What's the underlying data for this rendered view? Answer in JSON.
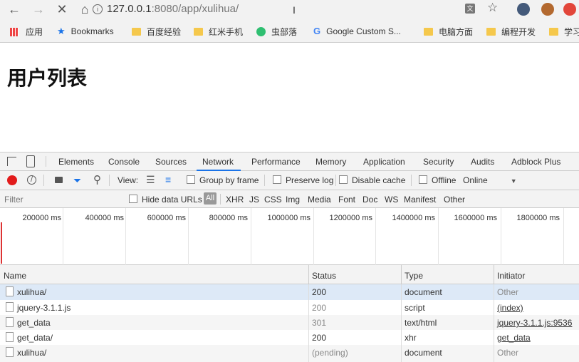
{
  "browser": {
    "url_host": "127.0.0.1",
    "url_rest": ":8080/app/xulihua/",
    "bookmarks": [
      "应用",
      "Bookmarks",
      "百度经验",
      "红米手机",
      "虫部落",
      "Google Custom S...",
      "电脑方面",
      "编程开发",
      "学习"
    ]
  },
  "page": {
    "title": "用户列表"
  },
  "devtools": {
    "tabs": [
      "Elements",
      "Console",
      "Sources",
      "Network",
      "Performance",
      "Memory",
      "Application",
      "Security",
      "Audits",
      "Adblock Plus"
    ],
    "active_tab": "Network",
    "toolbar": {
      "view_label": "View:",
      "group_by_frame": "Group by frame",
      "preserve_log": "Preserve log",
      "disable_cache": "Disable cache",
      "offline": "Offline",
      "throttle": "Online"
    },
    "filter": {
      "placeholder": "Filter",
      "hide_data_urls": "Hide data URLs",
      "all": "All",
      "types": [
        "XHR",
        "JS",
        "CSS",
        "Img",
        "Media",
        "Font",
        "Doc",
        "WS",
        "Manifest",
        "Other"
      ]
    },
    "timeline_ticks": [
      "200000 ms",
      "400000 ms",
      "600000 ms",
      "800000 ms",
      "1000000 ms",
      "1200000 ms",
      "1400000 ms",
      "1600000 ms",
      "1800000 ms"
    ],
    "columns": {
      "name": "Name",
      "status": "Status",
      "type": "Type",
      "initiator": "Initiator"
    },
    "requests": [
      {
        "name": "xulihua/",
        "status": "200",
        "type": "document",
        "initiator": "Other"
      },
      {
        "name": "jquery-3.1.1.js",
        "status": "200",
        "type": "script",
        "initiator": "(index)"
      },
      {
        "name": "get_data",
        "status": "301",
        "type": "text/html",
        "initiator": "jquery-3.1.1.js:9536"
      },
      {
        "name": "get_data/",
        "status": "200",
        "type": "xhr",
        "initiator": "get_data"
      },
      {
        "name": "xulihua/",
        "status": "(pending)",
        "type": "document",
        "initiator": "Other"
      }
    ]
  }
}
